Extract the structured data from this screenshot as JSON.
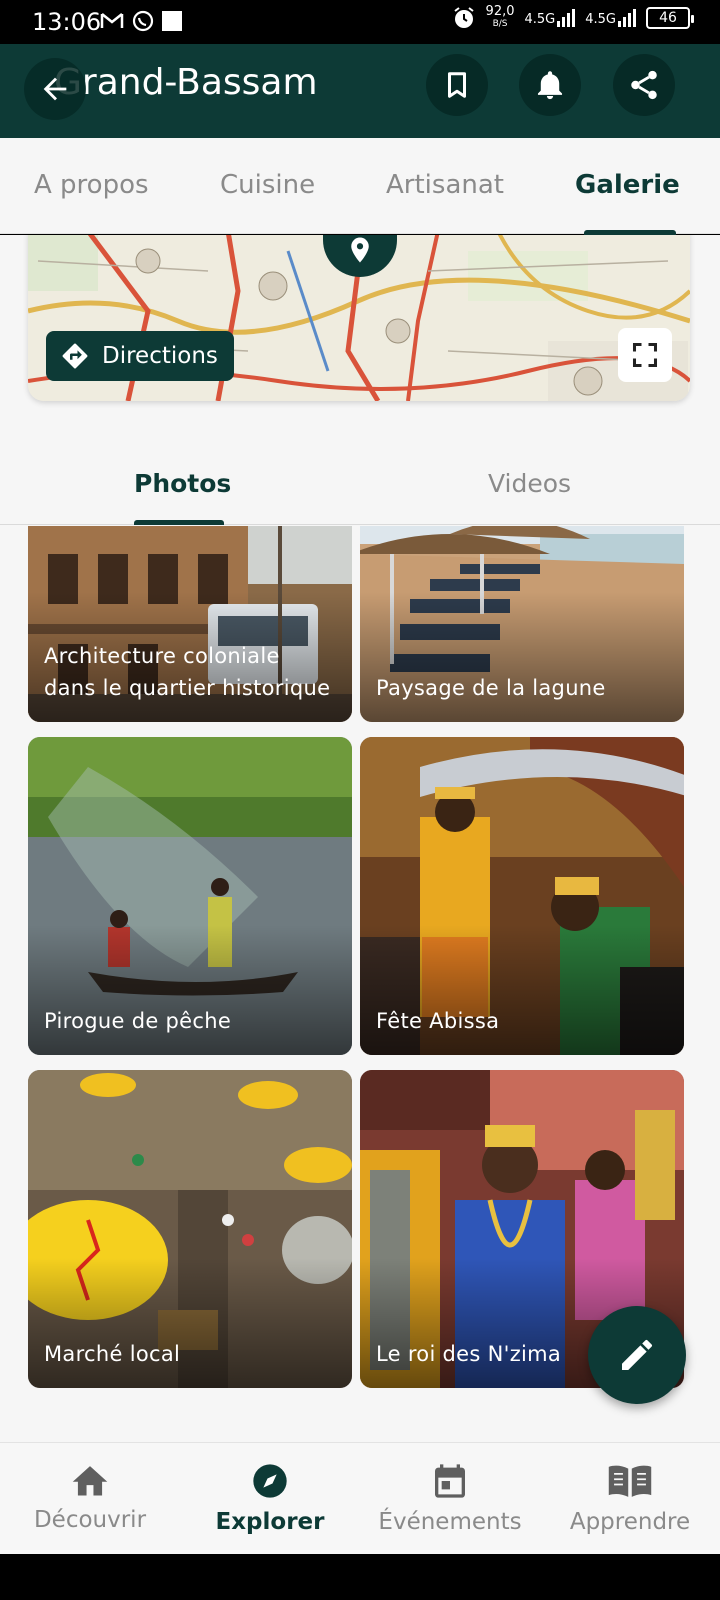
{
  "status_bar": {
    "time": "13:06",
    "speed_value": "92,0",
    "speed_unit": "B/S",
    "network1": "4.5G",
    "network2": "4.5G",
    "battery": "46"
  },
  "app_bar": {
    "title": "Grand-Bassam"
  },
  "top_tabs": [
    "A propos",
    "Cuisine",
    "Artisanat",
    "Galerie"
  ],
  "map": {
    "directions_label": "Directions"
  },
  "media_tabs": [
    "Photos",
    "Videos"
  ],
  "gallery": [
    {
      "caption": "Architecture coloniale dans le quartier historique"
    },
    {
      "caption": "Paysage de la lagune"
    },
    {
      "caption": "Pirogue de pêche"
    },
    {
      "caption": "Fête Abissa"
    },
    {
      "caption": "Marché local"
    },
    {
      "caption": "Le roi des N'zima"
    }
  ],
  "bottom_nav": [
    {
      "label": "Découvrir",
      "icon": "home-icon"
    },
    {
      "label": "Explorer",
      "icon": "compass-icon"
    },
    {
      "label": "Événements",
      "icon": "calendar-icon"
    },
    {
      "label": "Apprendre",
      "icon": "book-icon"
    }
  ],
  "colors": {
    "primary": "#0d3a36",
    "inactive": "#8a8a8a",
    "background": "#f6f6f6"
  }
}
